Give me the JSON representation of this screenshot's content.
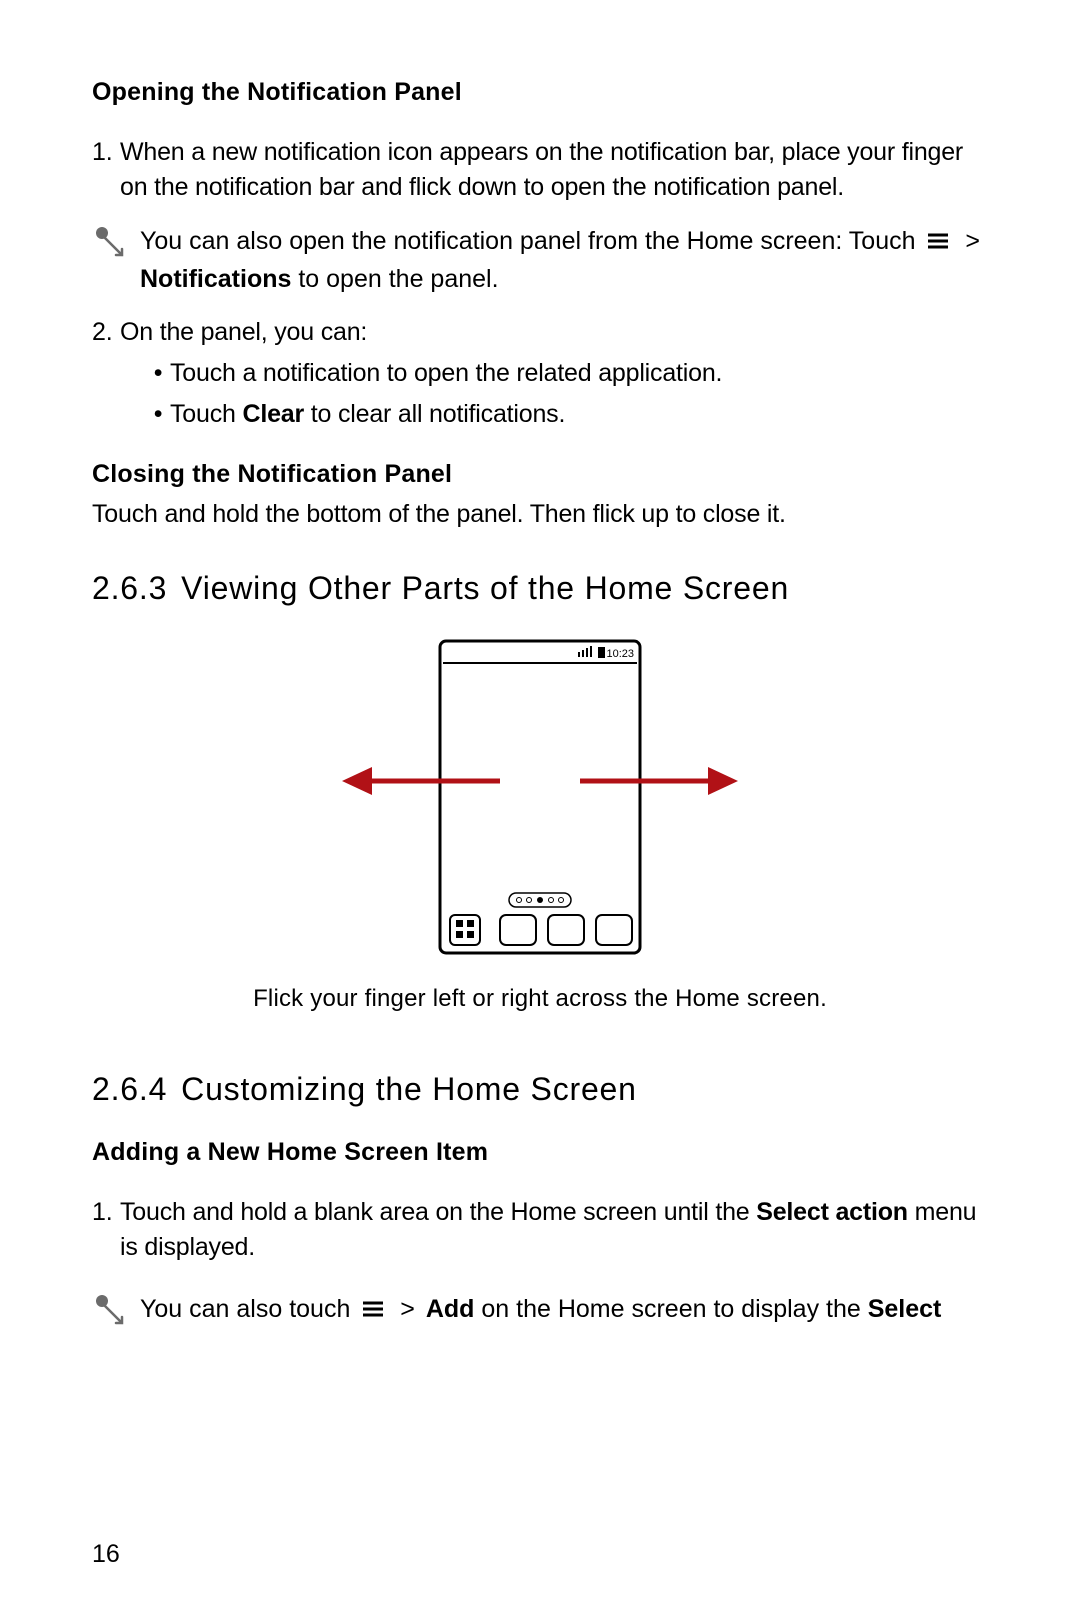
{
  "sections": {
    "opening_heading": "Opening the Notification Panel",
    "closing_heading": "Closing the Notification Panel",
    "closing_body": "Touch and hold the bottom of the panel. Then flick up to close it.",
    "s263_num": "2.6.3",
    "s263_title": "Viewing Other Parts of the Home Screen",
    "s264_num": "2.6.4",
    "s264_title": "Customizing the Home Screen",
    "adding_heading": "Adding a New Home Screen Item"
  },
  "ol1": {
    "num1": "1.",
    "item1": "When a new notification icon appears on the notification bar, place your finger on the notification bar and flick down to open the notification panel.",
    "num2": "2.",
    "item2": "On the panel, you can:",
    "sub1": "Touch a notification to open the related application.",
    "sub2_pre": "Touch ",
    "sub2_bold": "Clear",
    "sub2_post": " to clear all notifications."
  },
  "tip1": {
    "pre": "You can also open the notification panel from the Home screen: Touch ",
    "gt": ">",
    "bold": "Notifications",
    "post": " to open the panel."
  },
  "figure": {
    "status_time": "10:23",
    "caption": "Flick your finger left or right across the Home screen."
  },
  "ol2": {
    "num1": "1.",
    "item1_pre": "Touch and hold a blank area on the Home screen until the ",
    "item1_bold": "Select action",
    "item1_post": " menu is displayed."
  },
  "tip2": {
    "pre": "You can also touch ",
    "gt": ">",
    "bold1": "Add",
    "mid": " on the Home screen to display the ",
    "bold2": "Select"
  },
  "page_number": "16"
}
